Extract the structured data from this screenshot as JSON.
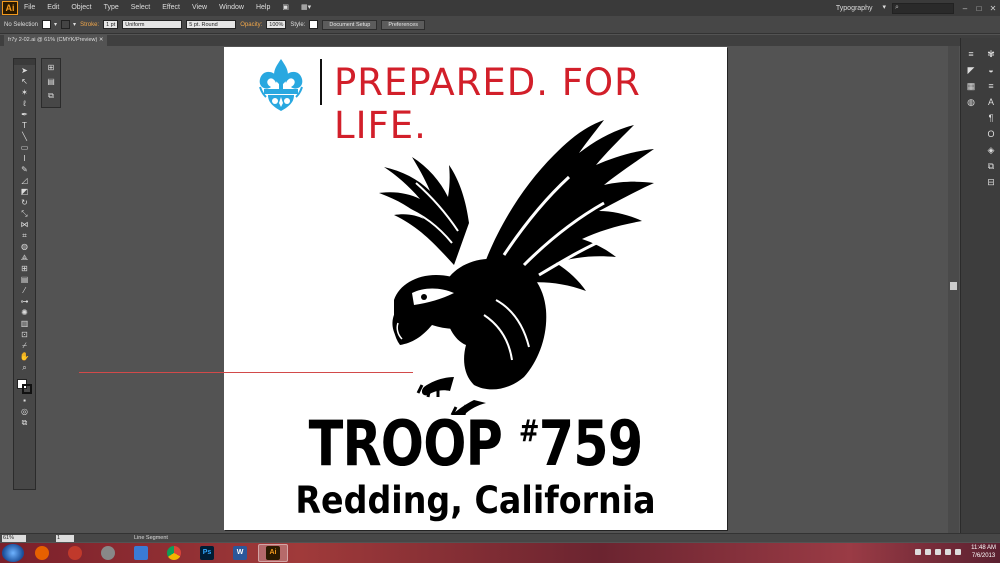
{
  "menubar": {
    "app_logo": "Ai",
    "items": [
      "File",
      "Edit",
      "Object",
      "Type",
      "Select",
      "Effect",
      "View",
      "Window",
      "Help"
    ],
    "workspace": "Typography"
  },
  "controlbar": {
    "selection": "No Selection",
    "stroke_label": "Stroke:",
    "stroke_weight": "1 pt",
    "profile": "Uniform",
    "brush": "5 pt. Round",
    "opacity_label": "Opacity:",
    "opacity_value": "100%",
    "style_label": "Style:",
    "document_setup": "Document Setup",
    "preferences": "Preferences"
  },
  "document": {
    "tab_title": "fr7y 2-02.ai @ 61% (CMYK/Preview)"
  },
  "artboard": {
    "slogan": "PREPARED. FOR LIFE.",
    "troop_hash": "#",
    "troop_prefix": "TROOP ",
    "troop_number": "759",
    "city": "Redding, California"
  },
  "statusbar": {
    "zoom": "61%",
    "page": "1",
    "status": "Line Segment"
  },
  "taskbar": {
    "time": "11:48 AM",
    "date": "7/6/2013"
  },
  "colors": {
    "slogan_red": "#d21f2a",
    "emblem_blue": "#29a8e0",
    "ui_gray": "#535353"
  }
}
